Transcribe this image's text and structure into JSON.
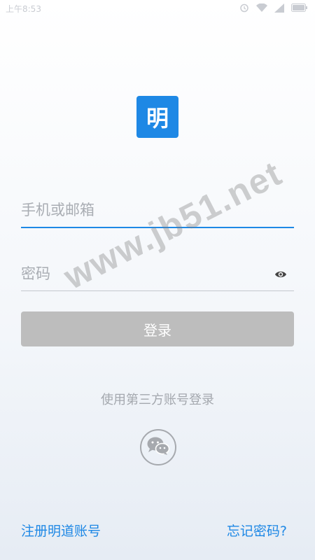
{
  "status_bar": {
    "time": "上午8:53",
    "icons": [
      "alarm-icon",
      "wifi-icon",
      "signal-icon",
      "battery-icon"
    ]
  },
  "logo": {
    "text": "明",
    "color": "#1e88e5"
  },
  "form": {
    "phone_placeholder": "手机或邮箱",
    "phone_value": "",
    "password_placeholder": "密码",
    "password_value": "",
    "login_label": "登录"
  },
  "third_party": {
    "label": "使用第三方账号登录",
    "icon": "wechat-icon"
  },
  "footer": {
    "register_label": "注册明道账号",
    "forgot_label": "忘记密码?"
  },
  "watermark": "www.jb51.net",
  "colors": {
    "accent": "#1e88e5",
    "button_disabled": "#bdbdbd"
  }
}
